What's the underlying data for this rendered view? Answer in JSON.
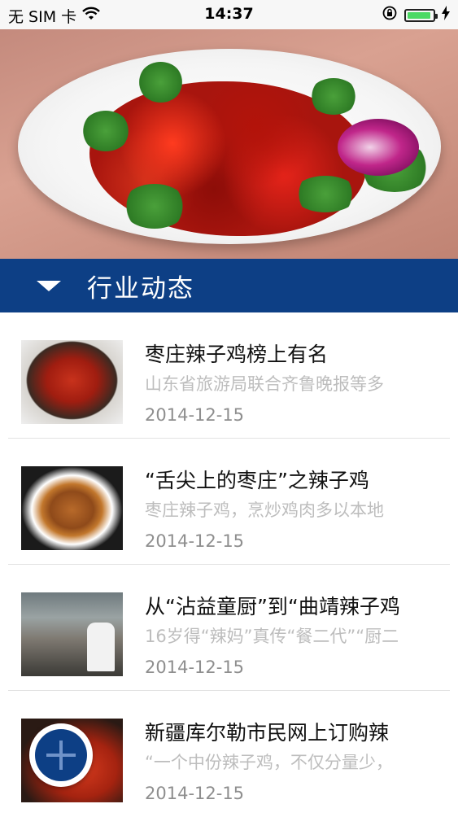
{
  "status_bar": {
    "carrier": "无 SIM 卡",
    "time": "14:37",
    "icons": [
      "wifi-icon",
      "rotation-lock-icon",
      "battery-icon",
      "charging-icon"
    ],
    "battery_color": "#4cd964"
  },
  "hero": {
    "image": "spicy-chicken-dish-photo"
  },
  "section": {
    "title": "行业动态",
    "icon": "triangle-down-icon",
    "background": "#0d3f85"
  },
  "news": [
    {
      "title": "枣庄辣子鸡榜上有名",
      "desc": "山东省旅游局联合齐鲁晚报等多",
      "date": "2014-12-15"
    },
    {
      "title": "“舌尖上的枣庄”之辣子鸡",
      "desc": "枣庄辣子鸡，烹炒鸡肉多以本地",
      "date": "2014-12-15"
    },
    {
      "title": "从“沾益童厨”到“曲靖辣子鸡",
      "desc": "16岁得“辣妈”真传“餐二代”“厨二",
      "date": "2014-12-15"
    },
    {
      "title": "新疆库尔勒市民网上订购辣",
      "desc": "“一个中份辣子鸡，不仅分量少，",
      "date": "2014-12-15"
    }
  ],
  "fab": {
    "icon": "plus-icon"
  }
}
